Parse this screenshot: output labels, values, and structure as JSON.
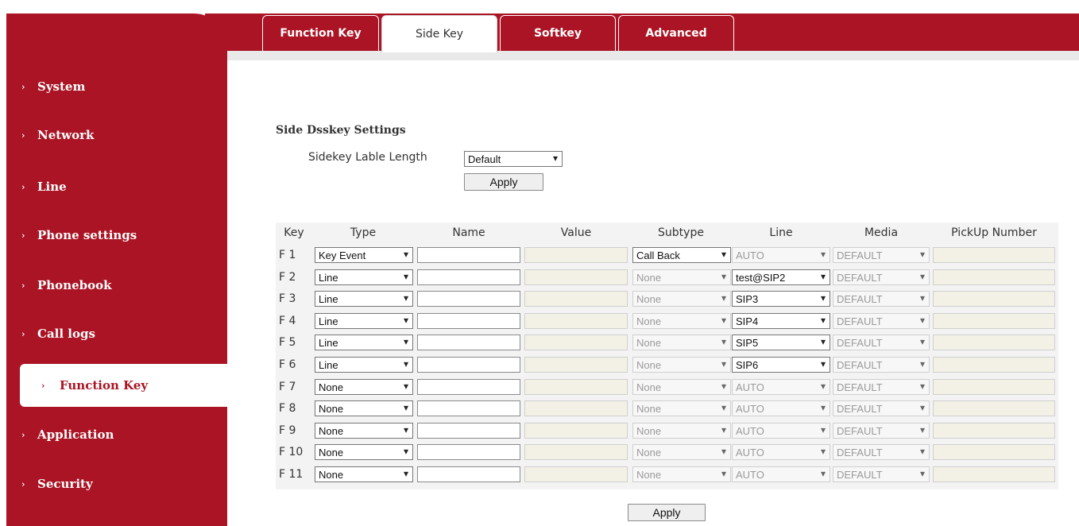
{
  "sidebar": {
    "items": [
      {
        "label": "System",
        "active": false
      },
      {
        "label": "Network",
        "active": false
      },
      {
        "label": "Line",
        "active": false
      },
      {
        "label": "Phone settings",
        "active": false
      },
      {
        "label": "Phonebook",
        "active": false
      },
      {
        "label": "Call logs",
        "active": false
      },
      {
        "label": "Function Key",
        "active": true
      },
      {
        "label": "Application",
        "active": false
      },
      {
        "label": "Security",
        "active": false
      }
    ],
    "chevron": "›"
  },
  "tabs": [
    {
      "label": "Function Key",
      "active": false
    },
    {
      "label": "Side Key",
      "active": true
    },
    {
      "label": "Softkey",
      "active": false
    },
    {
      "label": "Advanced",
      "active": false
    }
  ],
  "section": {
    "title": "Side Dsskey Settings",
    "length_label": "Sidekey Lable Length",
    "length_value": "Default",
    "apply_label": "Apply"
  },
  "table": {
    "headers": [
      "Key",
      "Type",
      "Name",
      "Value",
      "Subtype",
      "Line",
      "Media",
      "PickUp Number"
    ],
    "rows": [
      {
        "key": "F 1",
        "type": "Key Event",
        "name": "",
        "value": "",
        "subtype": "Call Back",
        "subtype_enabled": true,
        "line": "AUTO",
        "line_enabled": false,
        "media": "DEFAULT",
        "pickup": ""
      },
      {
        "key": "F 2",
        "type": "Line",
        "name": "",
        "value": "",
        "subtype": "None",
        "subtype_enabled": false,
        "line": "test@SIP2",
        "line_enabled": true,
        "media": "DEFAULT",
        "pickup": ""
      },
      {
        "key": "F 3",
        "type": "Line",
        "name": "",
        "value": "",
        "subtype": "None",
        "subtype_enabled": false,
        "line": "SIP3",
        "line_enabled": true,
        "media": "DEFAULT",
        "pickup": ""
      },
      {
        "key": "F 4",
        "type": "Line",
        "name": "",
        "value": "",
        "subtype": "None",
        "subtype_enabled": false,
        "line": "SIP4",
        "line_enabled": true,
        "media": "DEFAULT",
        "pickup": ""
      },
      {
        "key": "F 5",
        "type": "Line",
        "name": "",
        "value": "",
        "subtype": "None",
        "subtype_enabled": false,
        "line": "SIP5",
        "line_enabled": true,
        "media": "DEFAULT",
        "pickup": ""
      },
      {
        "key": "F 6",
        "type": "Line",
        "name": "",
        "value": "",
        "subtype": "None",
        "subtype_enabled": false,
        "line": "SIP6",
        "line_enabled": true,
        "media": "DEFAULT",
        "pickup": ""
      },
      {
        "key": "F 7",
        "type": "None",
        "name": "",
        "value": "",
        "subtype": "None",
        "subtype_enabled": false,
        "line": "AUTO",
        "line_enabled": false,
        "media": "DEFAULT",
        "pickup": ""
      },
      {
        "key": "F 8",
        "type": "None",
        "name": "",
        "value": "",
        "subtype": "None",
        "subtype_enabled": false,
        "line": "AUTO",
        "line_enabled": false,
        "media": "DEFAULT",
        "pickup": ""
      },
      {
        "key": "F 9",
        "type": "None",
        "name": "",
        "value": "",
        "subtype": "None",
        "subtype_enabled": false,
        "line": "AUTO",
        "line_enabled": false,
        "media": "DEFAULT",
        "pickup": ""
      },
      {
        "key": "F 10",
        "type": "None",
        "name": "",
        "value": "",
        "subtype": "None",
        "subtype_enabled": false,
        "line": "AUTO",
        "line_enabled": false,
        "media": "DEFAULT",
        "pickup": ""
      },
      {
        "key": "F 11",
        "type": "None",
        "name": "",
        "value": "",
        "subtype": "None",
        "subtype_enabled": false,
        "line": "AUTO",
        "line_enabled": false,
        "media": "DEFAULT",
        "pickup": ""
      }
    ],
    "apply_label": "Apply"
  },
  "colors": {
    "brand": "#ab1424",
    "panel": "#f3f3f3"
  },
  "icons": {
    "dropdown": "chevron-down-icon",
    "nav": "chevron-right-icon"
  }
}
